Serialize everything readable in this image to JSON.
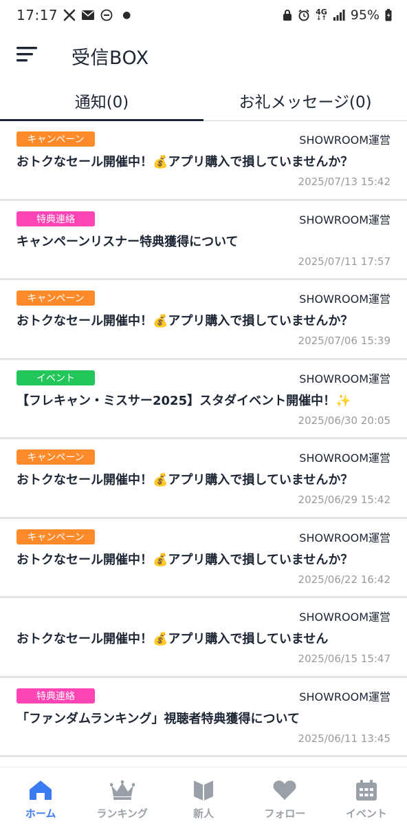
{
  "status_bar": {
    "time": "17:17",
    "network": "4G",
    "battery": "95%"
  },
  "header": {
    "title": "受信BOX",
    "menu_icon": "hamburger-icon"
  },
  "tabs": [
    {
      "label": "通知(0)",
      "active": true
    },
    {
      "label": "お礼メッセージ(0)",
      "active": false
    }
  ],
  "colors": {
    "campaign": "#ff8a2a",
    "bonus": "#ff45b5",
    "event": "#22c65a",
    "nav_active": "#3b7bf0",
    "nav_inactive": "#9aa0a8"
  },
  "notifications": [
    {
      "badge": "キャンペーン",
      "badge_color": "#ff8a2a",
      "sender": "SHOWROOM運営",
      "subject": "おトクなセール開催中！💰アプリ購入で損していませんか？",
      "date": "2025/07/13 15:42"
    },
    {
      "badge": "特典連絡",
      "badge_color": "#ff45b5",
      "sender": "SHOWROOM運営",
      "subject": "キャンペーンリスナー特典獲得について",
      "date": "2025/07/11 17:57"
    },
    {
      "badge": "キャンペーン",
      "badge_color": "#ff8a2a",
      "sender": "SHOWROOM運営",
      "subject": "おトクなセール開催中！💰アプリ購入で損していませんか？",
      "date": "2025/07/06 15:39"
    },
    {
      "badge": "イベント",
      "badge_color": "#22c65a",
      "sender": "SHOWROOM運営",
      "subject": "【フレキャン・ミスサー2025】スタダイベント開催中！✨",
      "date": "2025/06/30 20:05"
    },
    {
      "badge": "キャンペーン",
      "badge_color": "#ff8a2a",
      "sender": "SHOWROOM運営",
      "subject": "おトクなセール開催中！💰アプリ購入で損していませんか？",
      "date": "2025/06/29 15:42"
    },
    {
      "badge": "キャンペーン",
      "badge_color": "#ff8a2a",
      "sender": "SHOWROOM運営",
      "subject": "おトクなセール開催中！💰アプリ購入で損していませんか？",
      "date": "2025/06/22 16:42"
    },
    {
      "badge": "",
      "badge_color": "",
      "sender": "SHOWROOM運営",
      "subject": "おトクなセール開催中！💰アプリ購入で損していません",
      "date": "2025/06/15 15:47"
    },
    {
      "badge": "特典連絡",
      "badge_color": "#ff45b5",
      "sender": "SHOWROOM運営",
      "subject": "「ファンダムランキング」視聴者特典獲得について",
      "date": "2025/06/11 13:45"
    }
  ],
  "bottom_nav": [
    {
      "label": "ホーム",
      "icon": "home-icon",
      "active": true
    },
    {
      "label": "ランキング",
      "icon": "crown-icon",
      "active": false
    },
    {
      "label": "新人",
      "icon": "beginner-mark-icon",
      "active": false
    },
    {
      "label": "フォロー",
      "icon": "heart-icon",
      "active": false
    },
    {
      "label": "イベント",
      "icon": "calendar-icon",
      "active": false
    }
  ]
}
